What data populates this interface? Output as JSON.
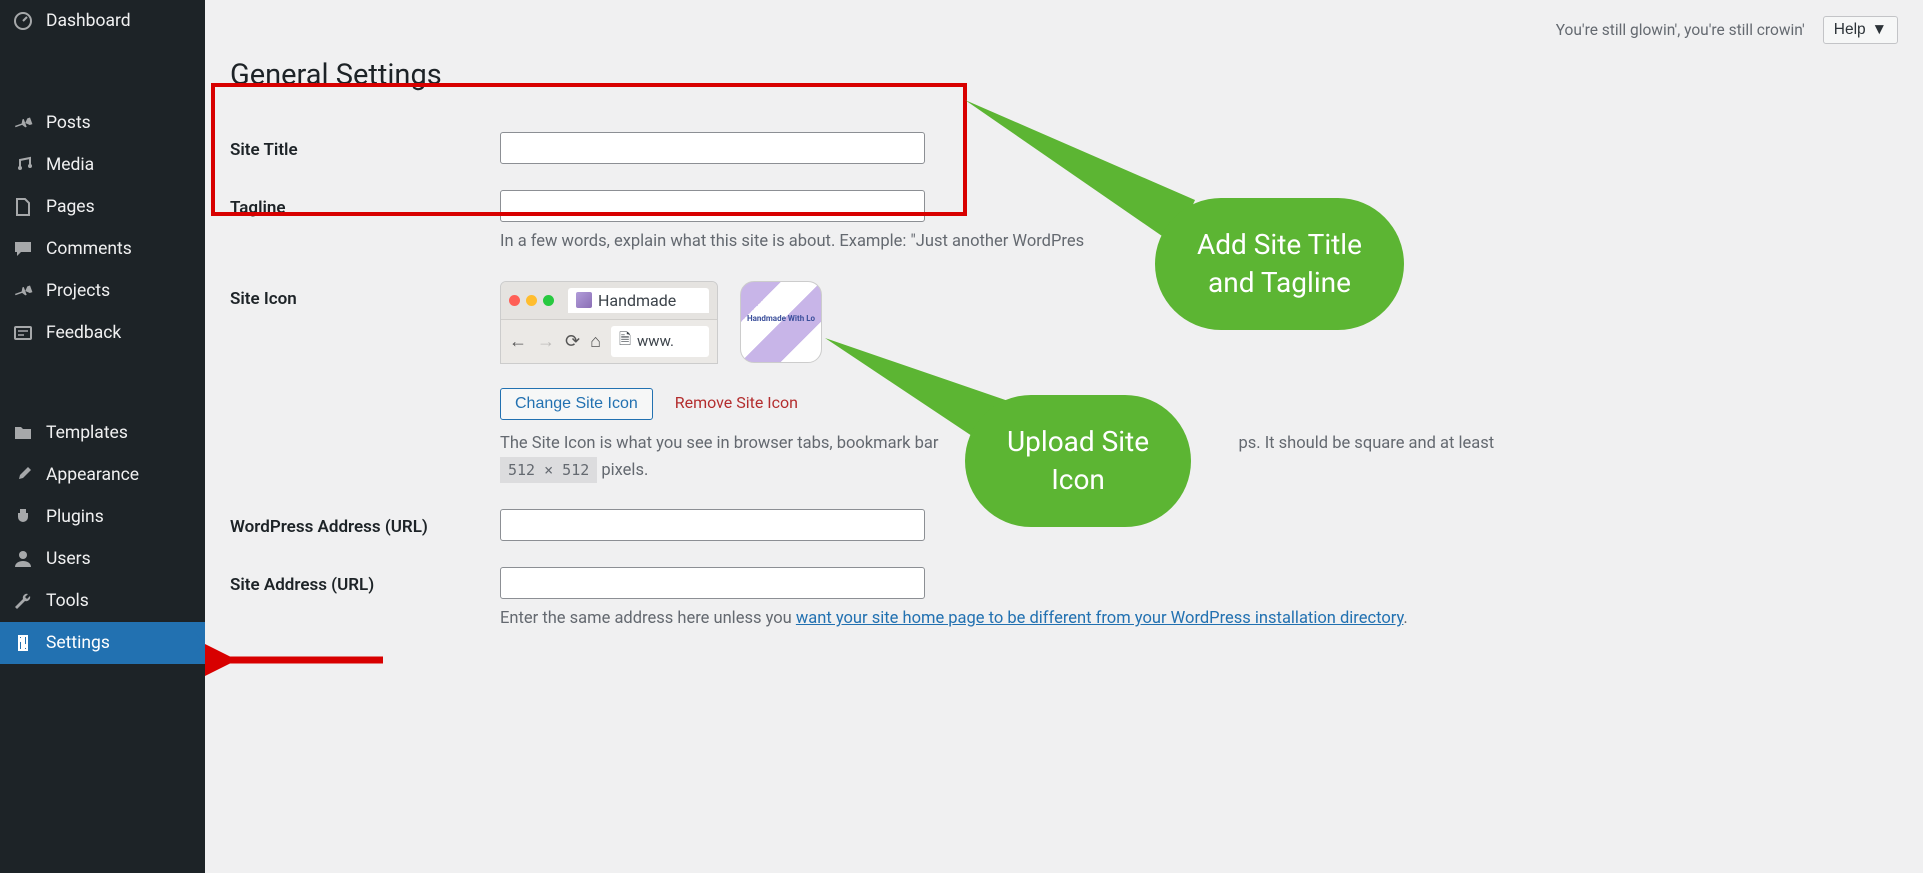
{
  "sidebar": {
    "items": [
      {
        "label": "Dashboard",
        "icon": "dashboard"
      },
      {
        "label": "Posts",
        "icon": "pin"
      },
      {
        "label": "Media",
        "icon": "media"
      },
      {
        "label": "Pages",
        "icon": "page"
      },
      {
        "label": "Comments",
        "icon": "comment"
      },
      {
        "label": "Projects",
        "icon": "pin"
      },
      {
        "label": "Feedback",
        "icon": "feedback"
      },
      {
        "label": "Templates",
        "icon": "folder"
      },
      {
        "label": "Appearance",
        "icon": "brush"
      },
      {
        "label": "Plugins",
        "icon": "plug"
      },
      {
        "label": "Users",
        "icon": "user"
      },
      {
        "label": "Tools",
        "icon": "wrench"
      },
      {
        "label": "Settings",
        "icon": "settings",
        "active": true
      }
    ]
  },
  "top_status": "You're still glowin', you're still crowin'",
  "help_label": "Help",
  "page_title": "General Settings",
  "form": {
    "site_title_label": "Site Title",
    "tagline_label": "Tagline",
    "tagline_desc_prefix": "In a few words, explain what this site is about. Example: \"Just another WordPres",
    "site_icon_label": "Site Icon",
    "tab_title": "Handmade",
    "url_text": "www.",
    "change_icon": "Change Site Icon",
    "remove_icon": "Remove Site Icon",
    "site_icon_desc_a": "The Site Icon is what you see in browser tabs, bookmark bar",
    "site_icon_desc_b": "ps. It should be square and at least ",
    "site_icon_size": "512 × 512",
    "site_icon_desc_c": " pixels.",
    "wp_address_label": "WordPress Address (URL)",
    "site_address_label": "Site Address (URL)",
    "site_address_desc_a": "Enter the same address here unless you ",
    "site_address_link": "want your site home page to be different from your WordPress installation directory",
    "site_address_desc_b": "."
  },
  "callouts": {
    "title_tagline": "Add Site Title\nand Tagline",
    "site_icon": "Upload Site\nIcon"
  }
}
